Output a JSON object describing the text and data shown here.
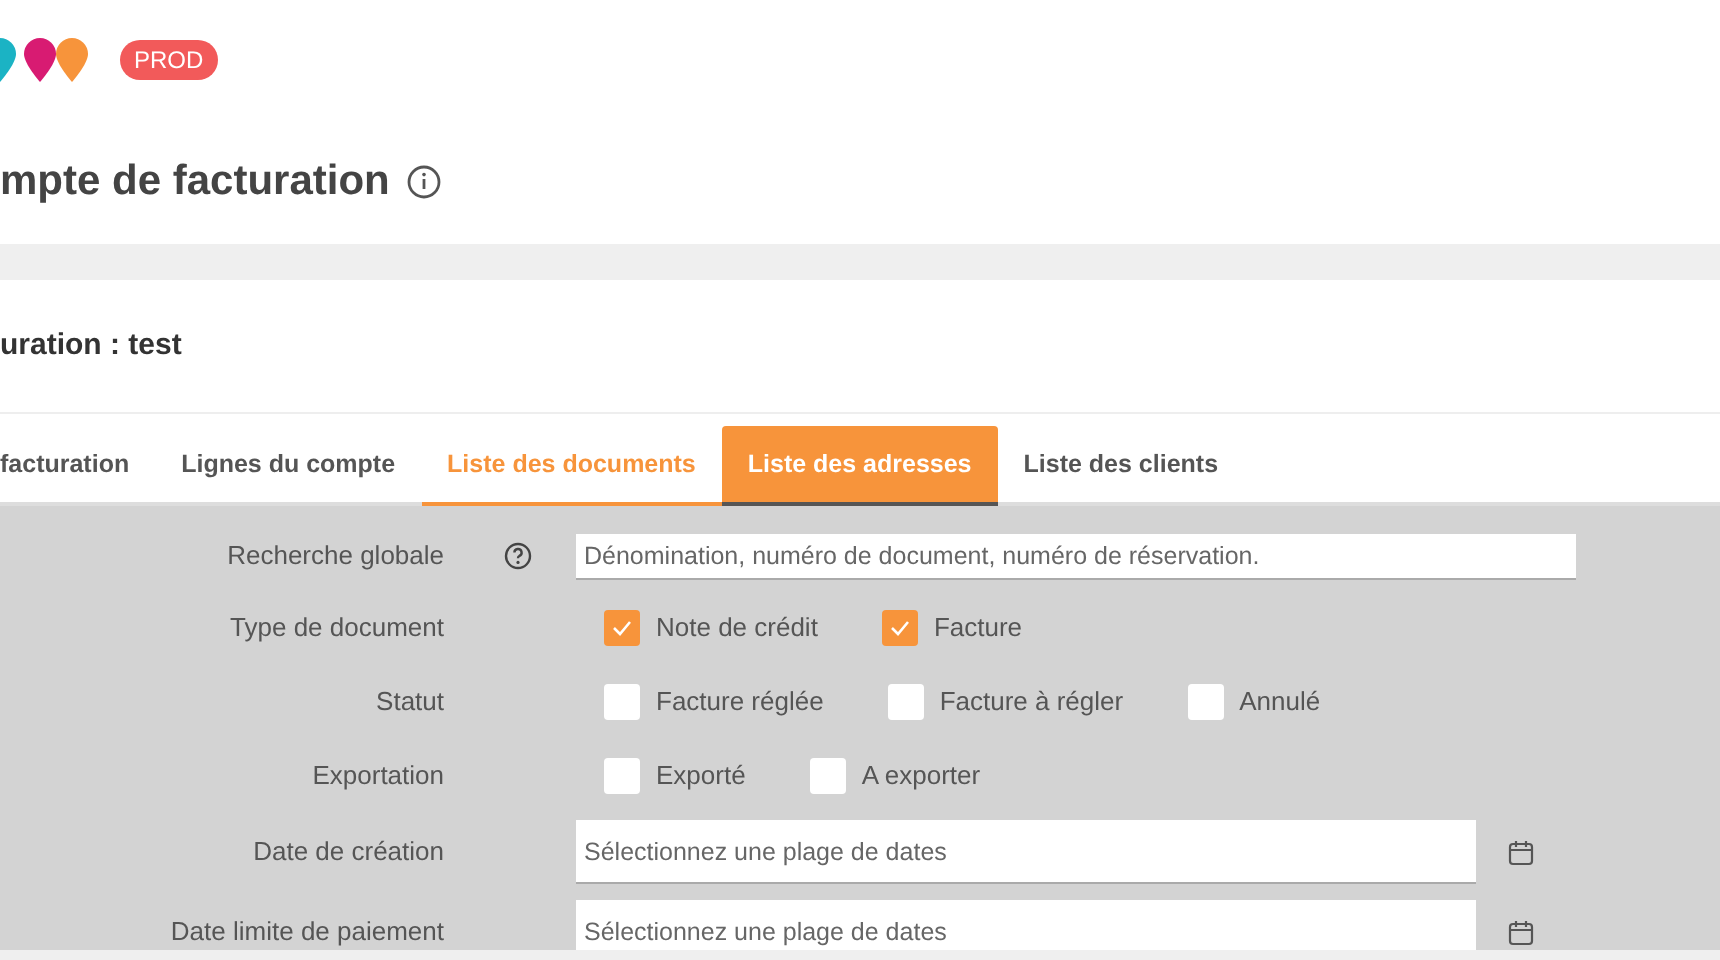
{
  "header": {
    "badge": "PROD"
  },
  "page_title": "mpte de facturation",
  "card_title": "uration : test",
  "tabs": [
    {
      "label": "facturation",
      "selected": false,
      "pressed": false
    },
    {
      "label": "Lignes du compte",
      "selected": false,
      "pressed": false
    },
    {
      "label": "Liste des documents",
      "selected": true,
      "pressed": false
    },
    {
      "label": "Liste des adresses",
      "selected": false,
      "pressed": true
    },
    {
      "label": "Liste des clients",
      "selected": false,
      "pressed": false
    }
  ],
  "filters": [
    {
      "kind": "text",
      "label": "Recherche globale",
      "help": true,
      "placeholder": "Dénomination, numéro de document, numéro de réservation."
    },
    {
      "kind": "checks",
      "label": "Type de document",
      "options": [
        {
          "label": "Note de crédit",
          "checked": true
        },
        {
          "label": "Facture",
          "checked": true
        }
      ]
    },
    {
      "kind": "checks",
      "label": "Statut",
      "options": [
        {
          "label": "Facture réglée",
          "checked": false
        },
        {
          "label": "Facture à régler",
          "checked": false
        },
        {
          "label": "Annulé",
          "checked": false
        }
      ]
    },
    {
      "kind": "checks",
      "label": "Exportation",
      "options": [
        {
          "label": "Exporté",
          "checked": false
        },
        {
          "label": "A exporter",
          "checked": false
        }
      ]
    },
    {
      "kind": "date",
      "label": "Date de création",
      "placeholder": "Sélectionnez une plage de dates"
    },
    {
      "kind": "date",
      "label": "Date limite de paiement",
      "placeholder": "Sélectionnez une plage de dates"
    }
  ]
}
